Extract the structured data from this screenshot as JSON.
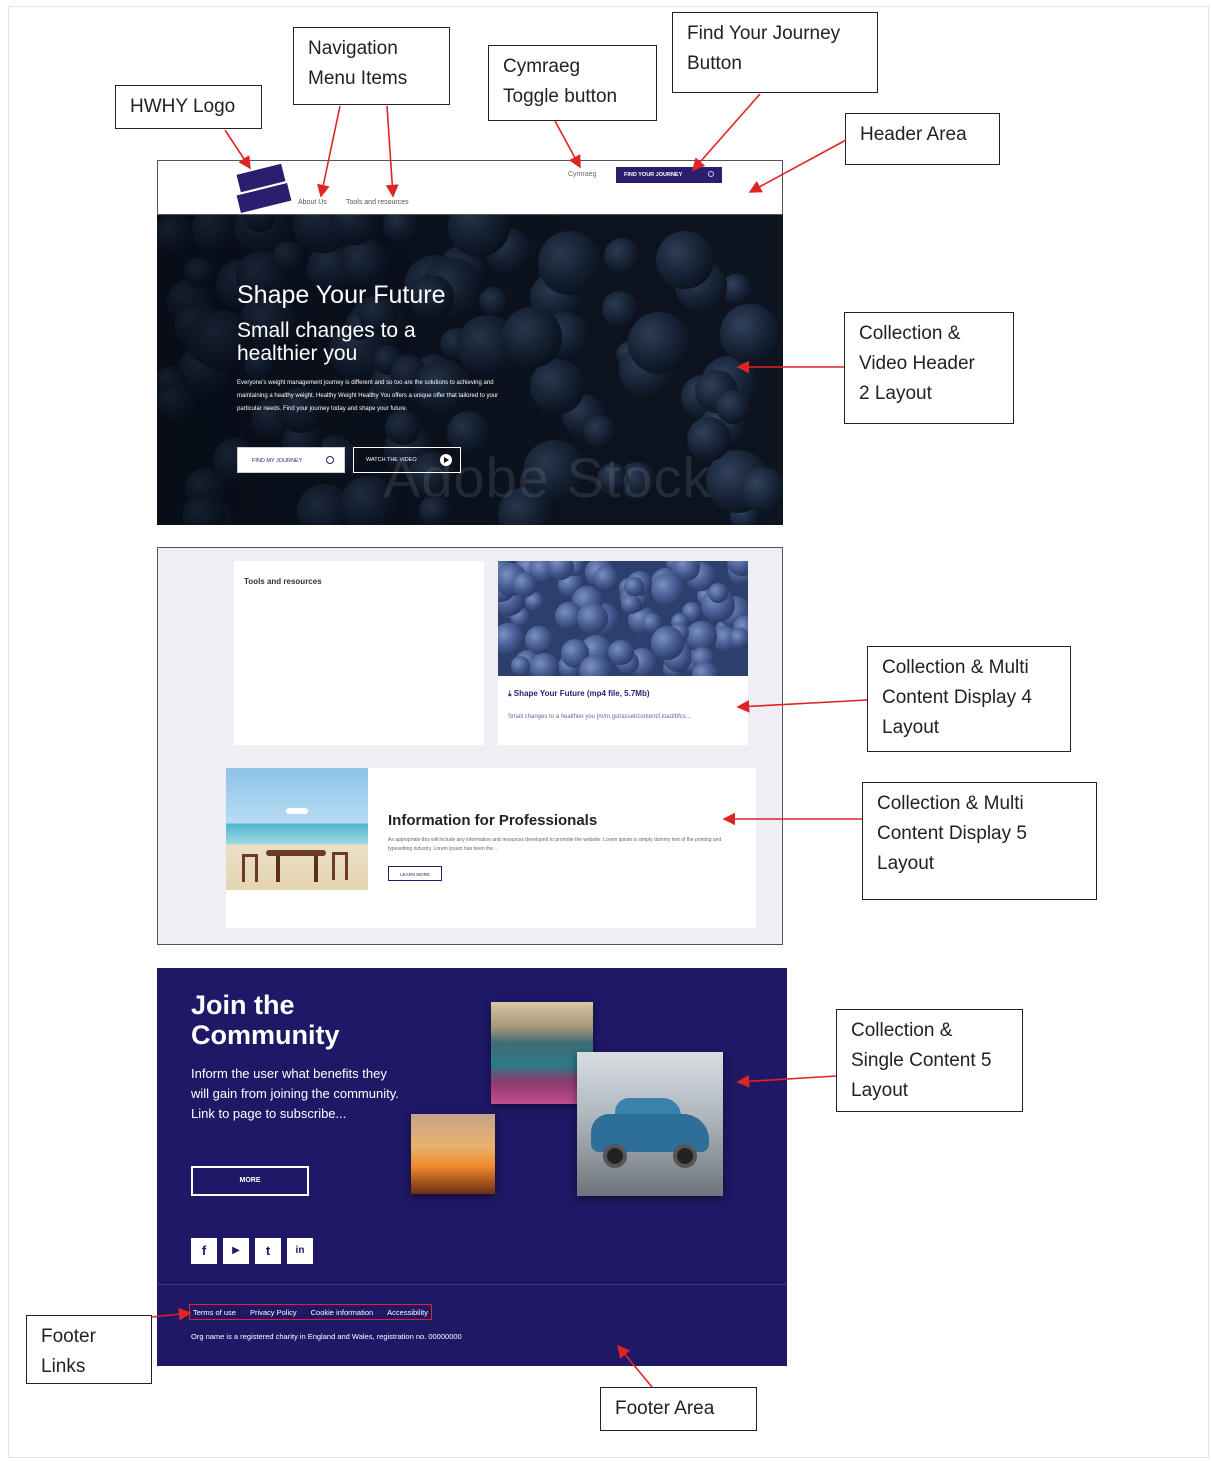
{
  "callouts": {
    "logo": "HWHY Logo",
    "nav": "Navigation\nMenu Items",
    "cymraeg": "Cymraeg\nToggle button",
    "journey": "Find Your Journey\nButton",
    "header": "Header Area",
    "video": "Collection &\nVideo Header\n2 Layout",
    "multi4": "Collection & Multi\nContent Display 4\nLayout",
    "multi5": "Collection & Multi\nContent Display 5\nLayout",
    "single5": "Collection &\nSingle Content 5\nLayout",
    "footer_links": "Footer\nLinks",
    "footer_area": "Footer Area"
  },
  "header": {
    "nav_items": [
      "About Us",
      "Tools and resources"
    ],
    "cymraeg": "Cymraeg",
    "journey_btn": "FIND YOUR JOURNEY"
  },
  "hero": {
    "title": "Shape Your Future",
    "subtitle": "Small changes to a healthier you",
    "body": "Everyone's weight management journey is different and so too are the solutions to achieving and maintaining a healthy weight. Healthy Weight Healthy You offers a unique offer that tailored to your particular needs. Find your journey today and shape your future.",
    "btn1": "FIND MY JOURNEY",
    "btn2": "WATCH THE VIDEO",
    "watermark": "Adobe Stock"
  },
  "multi": {
    "tools_title": "Tools and resources",
    "media_title": "Shape Your Future (mp4 file, 5.7Mb)",
    "media_sub": "Small changes to a healthier you [m/m.gst/asset/content/l.load/bfcs...",
    "pro_title": "Information for Professionals",
    "pro_body": "As appropriate this will include any information and resources developed to promote the website. Lorem ipsum is simply dummy text of the printing and typesetting industry. Lorem Ipsum has been the...",
    "pro_btn": "LEARN MORE"
  },
  "footer": {
    "title": "Join the Community",
    "body": "Inform the user what benefits they will gain from joining the community. Link to page to subscribe...",
    "more": "MORE",
    "social": [
      "f",
      "▶",
      "t",
      "in"
    ],
    "links": [
      "Terms of use",
      "Privacy Policy",
      "Cookie information",
      "Accessibility"
    ],
    "note": "Org name is a registered charity in England and Wales, registration no. 00000000"
  },
  "colors": {
    "brand": "#2a1f6e",
    "footer_bg": "#1f1866",
    "arrow": "#e02424"
  }
}
